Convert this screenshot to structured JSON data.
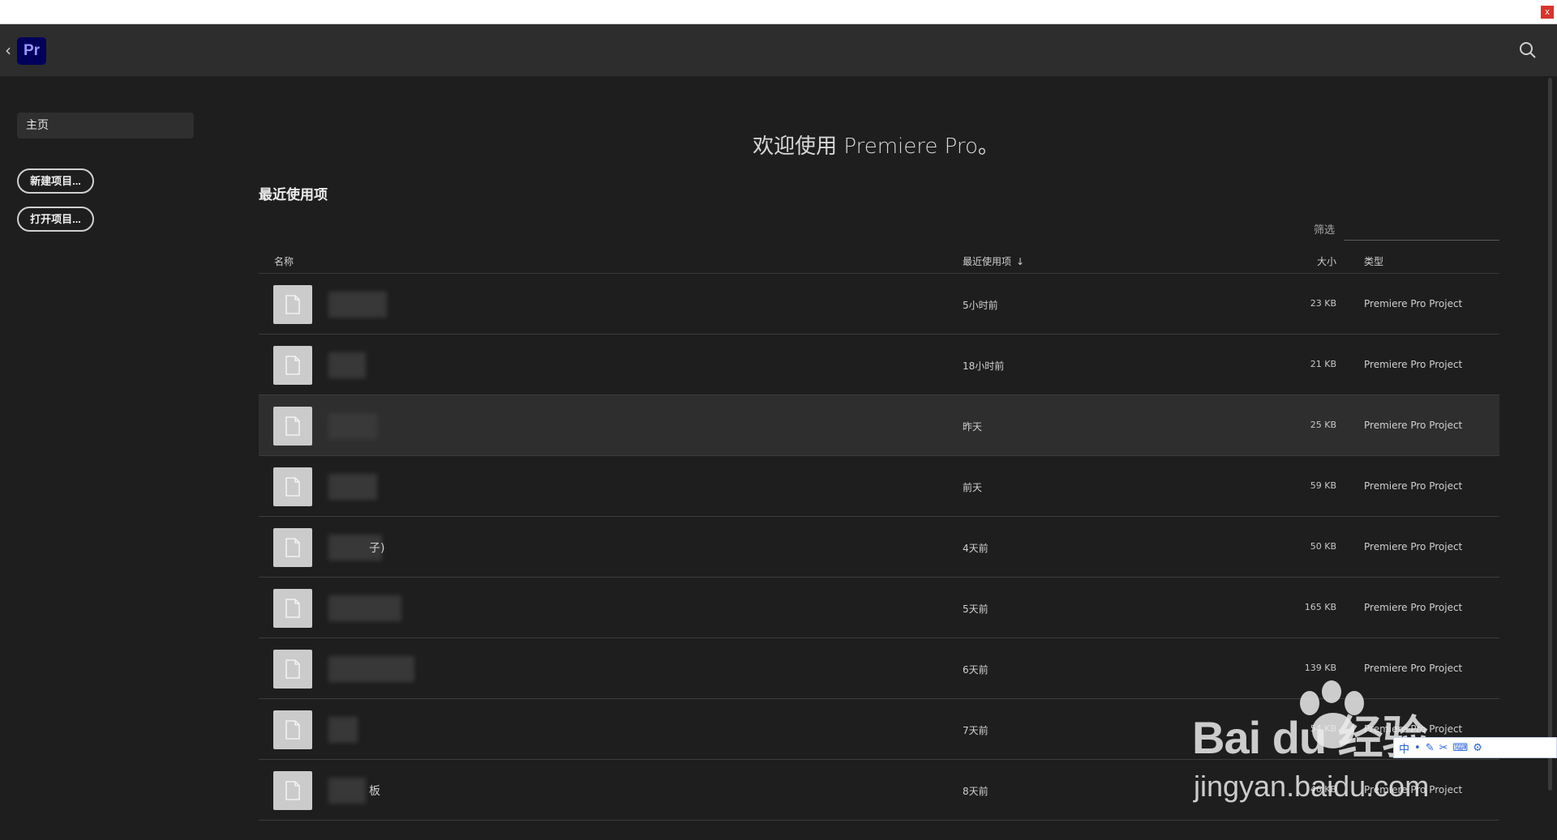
{
  "top_strip": {
    "close_label": "x"
  },
  "header": {
    "logo_text": "Pr",
    "back_icon": "chevron-left-icon",
    "search_icon": "search-icon"
  },
  "sidebar": {
    "home_label": "主页",
    "new_project_label": "新建项目...",
    "open_project_label": "打开项目..."
  },
  "main": {
    "welcome": "欢迎使用 Premiere Pro。",
    "recent_title": "最近使用项",
    "filter_label": "筛选",
    "columns": {
      "name": "名称",
      "recent": "最近使用项",
      "size": "大小",
      "type": "类型"
    },
    "rows": [
      {
        "name_suffix": "",
        "time": "5小时前",
        "size": "23 KB",
        "type": "Premiere Pro Project",
        "selected": false
      },
      {
        "name_suffix": "",
        "time": "18小时前",
        "size": "21 KB",
        "type": "Premiere Pro Project",
        "selected": false
      },
      {
        "name_suffix": "",
        "time": "昨天",
        "size": "25 KB",
        "type": "Premiere Pro Project",
        "selected": true
      },
      {
        "name_suffix": "",
        "time": "前天",
        "size": "59 KB",
        "type": "Premiere Pro Project",
        "selected": false
      },
      {
        "name_suffix": "子)",
        "time": "4天前",
        "size": "50 KB",
        "type": "Premiere Pro Project",
        "selected": false
      },
      {
        "name_suffix": "",
        "time": "5天前",
        "size": "165 KB",
        "type": "Premiere Pro Project",
        "selected": false
      },
      {
        "name_suffix": "",
        "time": "6天前",
        "size": "139 KB",
        "type": "Premiere Pro Project",
        "selected": false
      },
      {
        "name_suffix": "",
        "time": "7天前",
        "size": "54 KB",
        "type": "Premiere Pro Project",
        "selected": false
      },
      {
        "name_suffix": "板",
        "time": "8天前",
        "size": "46 KB",
        "type": "Premiere Pro Project",
        "selected": false
      }
    ]
  },
  "watermark": {
    "logo": "Bai du 经验",
    "url": "jingyan.baidu.com"
  },
  "ime_toolbar": {
    "label": "中"
  },
  "colors": {
    "background": "#1e1e1e",
    "header": "#2d2d2d",
    "logo_bg": "#00005b",
    "logo_fg": "#9999ff"
  }
}
